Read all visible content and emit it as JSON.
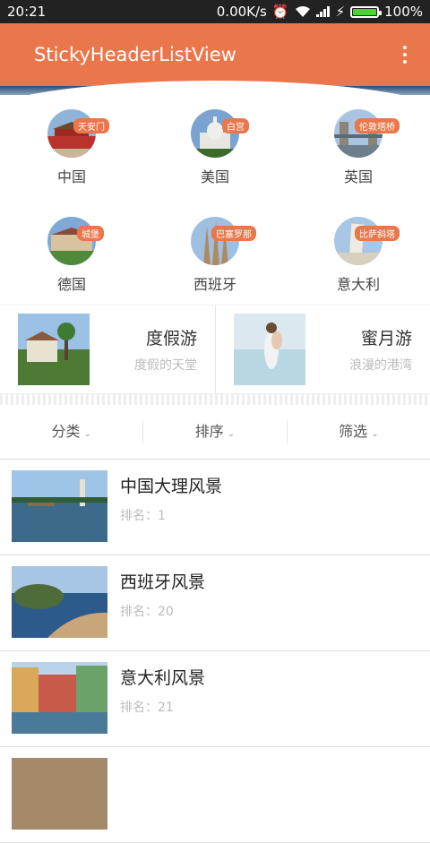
{
  "status_bar": {
    "time": "20:21",
    "speed": "0.00K/s",
    "battery": "100%"
  },
  "app_bar": {
    "title": "StickyHeaderListView"
  },
  "countries": [
    {
      "name": "中国",
      "badge": "天安门"
    },
    {
      "name": "美国",
      "badge": "白宫"
    },
    {
      "name": "英国",
      "badge": "伦敦塔桥"
    },
    {
      "name": "德国",
      "badge": "城堡"
    },
    {
      "name": "西班牙",
      "badge": "巴塞罗那"
    },
    {
      "name": "意大利",
      "badge": "比萨斜塔"
    }
  ],
  "promos": [
    {
      "title": "度假游",
      "subtitle": "度假的天堂"
    },
    {
      "title": "蜜月游",
      "subtitle": "浪漫的港湾"
    }
  ],
  "filters": [
    "分类",
    "排序",
    "筛选"
  ],
  "list": [
    {
      "title": "中国大理风景",
      "rank": "排名：1"
    },
    {
      "title": "西班牙风景",
      "rank": "排名：20"
    },
    {
      "title": "意大利风景",
      "rank": "排名：21"
    }
  ],
  "colors": {
    "accent": "#e9774b",
    "status_bar": "#222222"
  }
}
